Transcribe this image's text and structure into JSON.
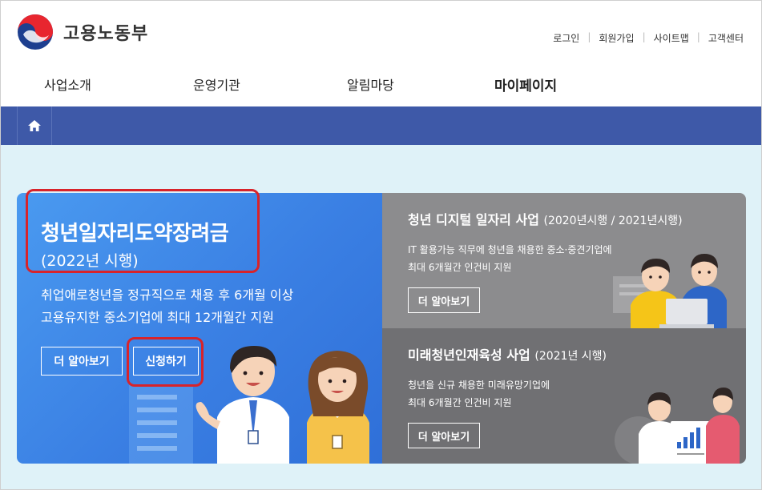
{
  "header": {
    "logo_text": "고용노동부",
    "util_links": [
      "로그인",
      "회원가입",
      "사이트맵",
      "고객센터"
    ]
  },
  "gnb": {
    "items": [
      "사업소개",
      "운영기관",
      "알림마당",
      "마이페이지"
    ],
    "active": "마이페이지"
  },
  "hero": {
    "title": "청년일자리도약장려금",
    "subtitle": "(2022년 시행)",
    "desc_line1": "취업애로청년을 정규직으로 채용 후 6개월 이상",
    "desc_line2": "고용유지한 중소기업에 최대 12개월간 지원",
    "more_label": "더 알아보기",
    "apply_label": "신청하기"
  },
  "card_digital": {
    "title": "청년 디지털 일자리 사업",
    "period": "(2020년시행 / 2021년시행)",
    "desc_line1": "IT 활용가능 직무에 청년을 채용한 중소·중견기업에",
    "desc_line2": "최대 6개월간 인건비 지원",
    "more_label": "더 알아보기"
  },
  "card_future": {
    "title": "미래청년인재육성 사업",
    "period": "(2021년 시행)",
    "desc_line1": "청년을 신규 채용한 미래유망기업에",
    "desc_line2": "최대 6개월간 인건비 지원",
    "more_label": "더 알아보기"
  },
  "colors": {
    "navbar": "#3e59a8",
    "hero_blue": "#3a7fe3",
    "highlight_red": "#d8232a",
    "card_gray_top": "#8c8c8e",
    "card_gray_bottom": "#707073"
  },
  "icons": {
    "logo": "taegeuk-logo-icon",
    "home": "home-icon"
  }
}
